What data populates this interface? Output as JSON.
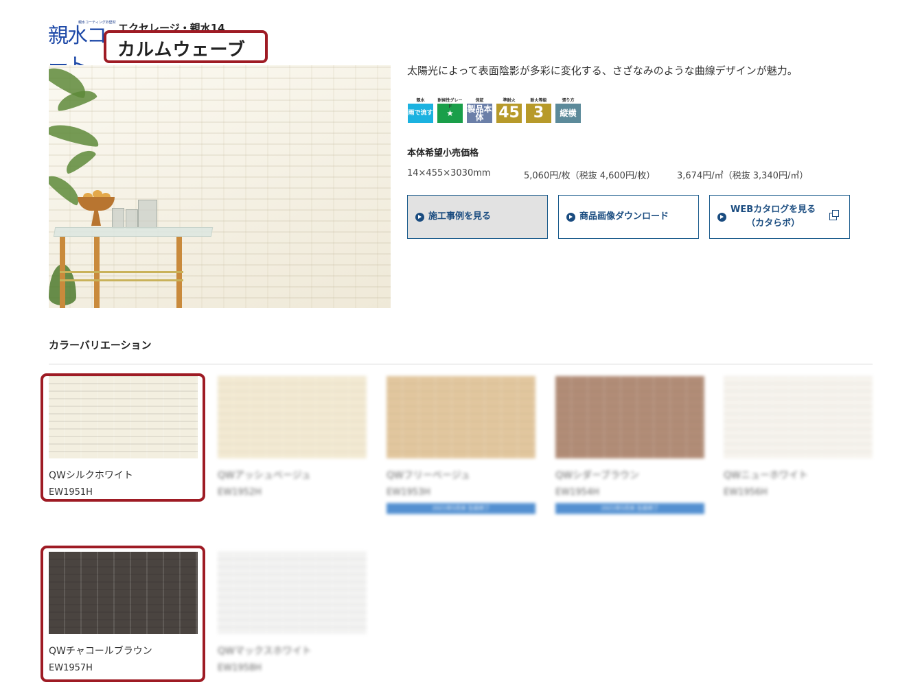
{
  "header": {
    "logo_text": "親水コート",
    "logo_subtext": "親水コーティング外壁材",
    "series": "エクセレージ・親水14",
    "title": "カルムウェーブ"
  },
  "product": {
    "description": "太陽光によって表面陰影が多彩に変化する、さざなみのような曲線デザインが魅力。",
    "badges": [
      {
        "top": "親水",
        "main": "雨で流す",
        "color": "#1bb2e0",
        "icon": "rain-wash-badge"
      },
      {
        "top": "耐候性グレード",
        "main": "★",
        "color": "#1a9f4a",
        "icon": "weather-grade-badge"
      },
      {
        "top": "保証",
        "main": "製品本体",
        "color": "#6b7fa8",
        "icon": "warranty-badge"
      },
      {
        "top": "準耐火",
        "main": "45",
        "color": "#b79a2a",
        "icon": "fire-45-badge"
      },
      {
        "top": "耐火等級",
        "main": "3",
        "color": "#b79a2a",
        "icon": "fire-grade-badge"
      },
      {
        "top": "張り方",
        "main": "縦横",
        "color": "#5c8a9a",
        "icon": "orientation-badge"
      }
    ],
    "price_heading": "本体希望小売価格",
    "size": "14×455×3030mm",
    "price_per_sheet": "5,060円/枚（税抜 4,600円/枚）",
    "price_per_sqm": "3,674円/㎡（税抜 3,340円/㎡）"
  },
  "buttons": {
    "cases": "施工事例を見る",
    "download": "商品画像ダウンロード",
    "catalog_line1": "WEBカタログを見る",
    "catalog_line2": "（カタらボ）"
  },
  "colors_section": {
    "title": "カラーバリエーション",
    "swatches": [
      {
        "name": "QWシルクホワイト",
        "code": "EW1951H",
        "color": "#f3efe0",
        "blurred": false
      },
      {
        "name": "QWアッシュベージュ",
        "code": "EW1952H",
        "color": "#efe3c4",
        "blurred": true
      },
      {
        "name": "QWフリーベージュ",
        "code": "EW1953H",
        "color": "#d9b57f",
        "blurred": true,
        "end_label": "2021年5月末 生産終了"
      },
      {
        "name": "QWシダーブラウン",
        "code": "EW1954H",
        "color": "#98674a",
        "blurred": true,
        "end_label": "2021年5月末 生産終了"
      },
      {
        "name": "QWニューホワイト",
        "code": "EW1956H",
        "color": "#f4f0e8",
        "blurred": true
      },
      {
        "name": "QWチャコールブラウン",
        "code": "EW1957H",
        "color": "#4a4440",
        "blurred": false
      },
      {
        "name": "QWマックスホワイト",
        "code": "EW1958H",
        "color": "#efefee",
        "blurred": true
      }
    ]
  }
}
